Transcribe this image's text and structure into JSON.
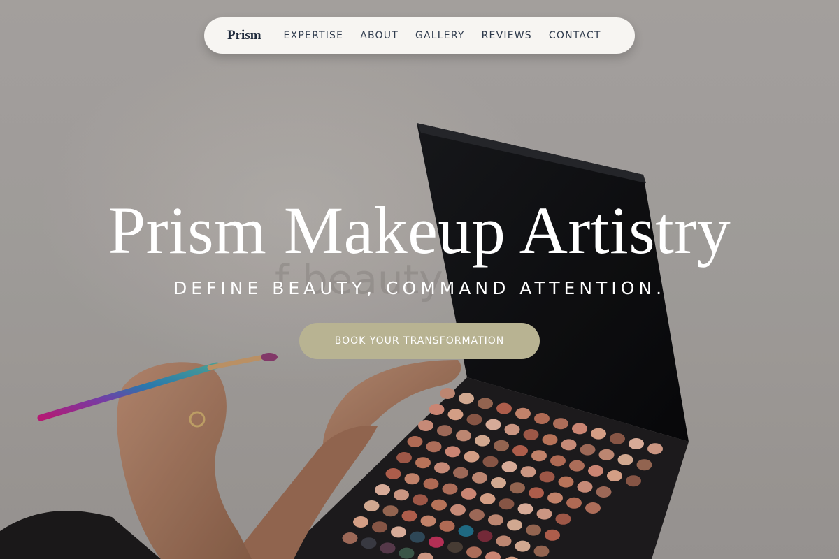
{
  "nav": {
    "brand": "Prism",
    "links": [
      "EXPERTISE",
      "ABOUT",
      "GALLERY",
      "REVIEWS",
      "CONTACT"
    ]
  },
  "hero": {
    "background_watermark": "f beauty",
    "title": "Prism Makeup Artistry",
    "subtitle": "DEFINE BEAUTY, COMMAND ATTENTION.",
    "cta_label": "BOOK YOUR TRANSFORMATION"
  },
  "colors": {
    "nav_background": "#f7f5f2",
    "nav_text": "#2e3a4c",
    "brand_text": "#1f2a3c",
    "cta_background": "#b8b392",
    "hero_text": "#ffffff"
  }
}
